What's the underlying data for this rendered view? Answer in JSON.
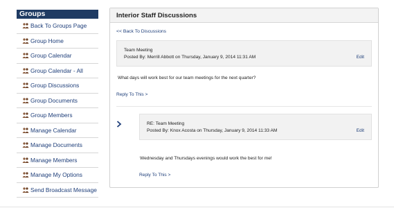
{
  "sidebar": {
    "title": "Groups",
    "items": [
      {
        "label": "Back To Groups Page"
      },
      {
        "label": "Group Home"
      },
      {
        "label": "Group Calendar"
      },
      {
        "label": "Group Calendar - All"
      },
      {
        "label": "Group Discussions"
      },
      {
        "label": "Group Documents"
      },
      {
        "label": "Group Members"
      },
      {
        "label": "Manage Calendar"
      },
      {
        "label": "Manage Documents"
      },
      {
        "label": "Manage Members"
      },
      {
        "label": "Manage My Options"
      },
      {
        "label": "Send Broadcast Message"
      }
    ],
    "item_icon": "people-icon"
  },
  "panel": {
    "title": "Interior Staff Discussions",
    "back_link": "<< Back To Discussions"
  },
  "posts": [
    {
      "subject": "Team Meeting",
      "posted_by": "Posted By: Merrill Abbott on Thursday, January 9, 2014 11:31 AM",
      "edit": "Edit",
      "body": "What days will work best for our team meetings for the next quarter?",
      "reply": "Reply To This >"
    },
    {
      "subject": "RE: Team Meeting",
      "posted_by": "Posted By: Knox Acosta on Thursday, January 9, 2014 11:33 AM",
      "edit": "Edit",
      "body": "Wednesday and Thursdays evenings would work the best for me!",
      "reply": "Reply To This >"
    }
  ],
  "colors": {
    "sidebar_header": "#1f3b63",
    "link": "#1f3f7a",
    "post_box": "#f2f2f2"
  }
}
